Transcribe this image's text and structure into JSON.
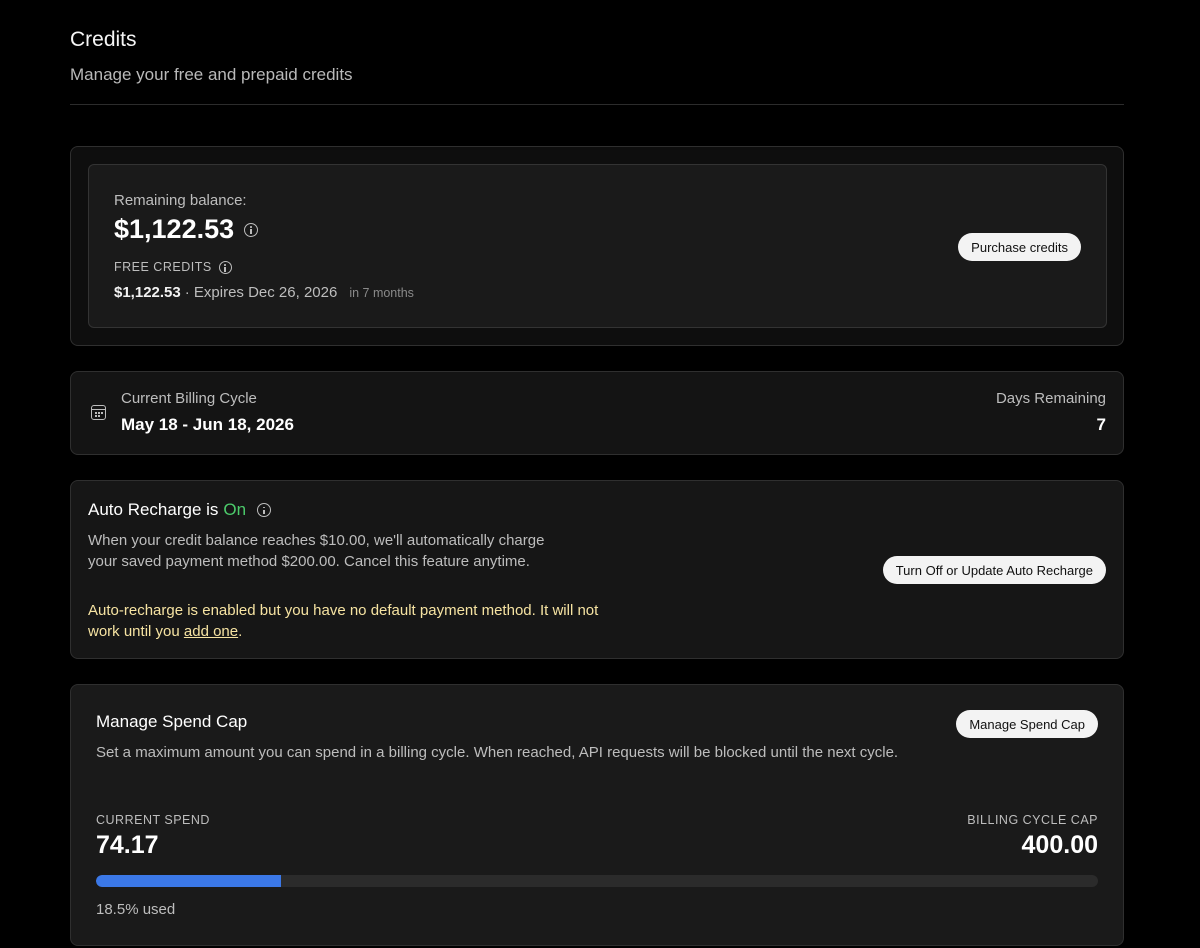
{
  "header": {
    "title": "Credits",
    "subtitle": "Manage your free and prepaid credits"
  },
  "balance": {
    "label": "Remaining balance:",
    "amount": "$1,122.53",
    "free_credits_label": "FREE CREDITS",
    "free_amount": "$1,122.53",
    "free_expiry": "· Expires Dec 26, 2026",
    "free_relative": "in 7 months",
    "purchase_button": "Purchase credits"
  },
  "billing_cycle": {
    "label": "Current Billing Cycle",
    "dates": "May 18 - Jun 18, 2026",
    "days_label": "Days Remaining",
    "days_value": "7"
  },
  "auto_recharge": {
    "title_prefix": "Auto Recharge is",
    "status": "On",
    "status_color": "#4ccb6b",
    "description": "When your credit balance reaches $10.00, we'll automatically charge your saved payment method $200.00. Cancel this feature anytime.",
    "warning_text": "Auto-recharge is enabled but you have no default payment method. It will not work until you",
    "warning_link": "add one",
    "warning_end": ".",
    "button": "Turn Off or Update Auto Recharge"
  },
  "spend_cap": {
    "title": "Manage Spend Cap",
    "description": "Set a maximum amount you can spend in a billing cycle. When reached, API requests will be blocked until the next cycle.",
    "button": "Manage Spend Cap",
    "current_label": "CURRENT SPEND",
    "current_value": "74.17",
    "cap_label": "BILLING CYCLE CAP",
    "cap_value": "400.00",
    "used_fraction": 0.185,
    "used_text": "18.5% used",
    "bar_color": "#3b78e7"
  }
}
